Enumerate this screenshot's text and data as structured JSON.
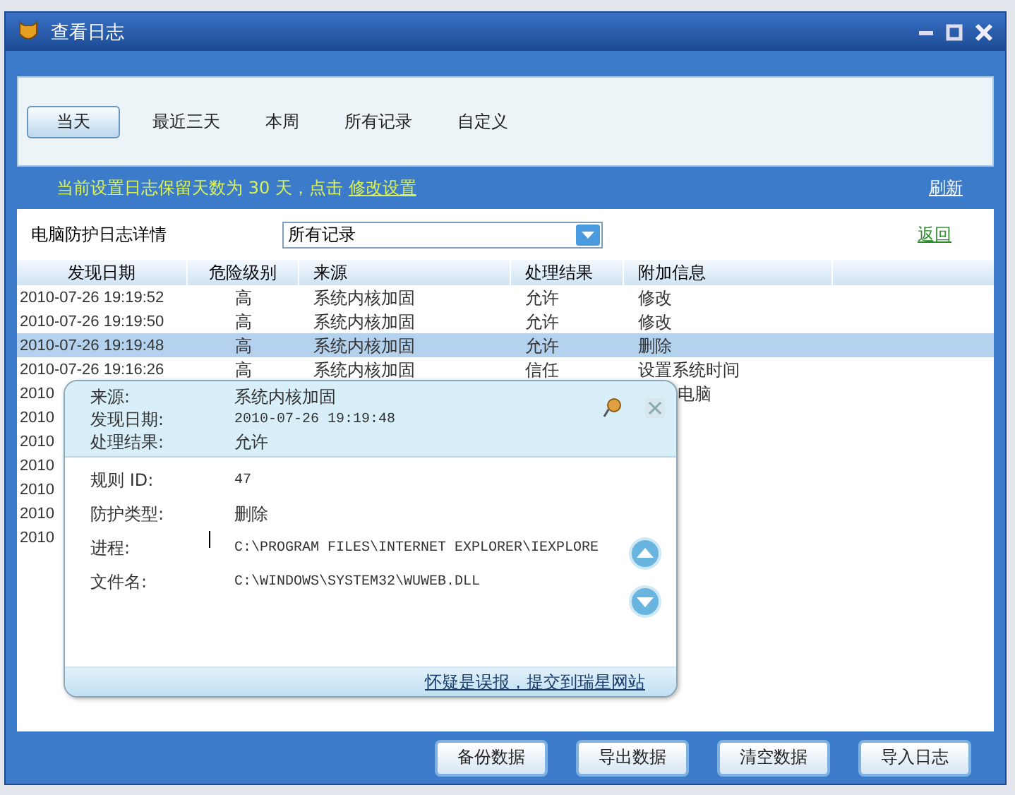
{
  "window": {
    "title": "查看日志"
  },
  "tabs": [
    {
      "label": "当天",
      "selected": true
    },
    {
      "label": "最近三天",
      "selected": false
    },
    {
      "label": "本周",
      "selected": false
    },
    {
      "label": "所有记录",
      "selected": false
    },
    {
      "label": "自定义",
      "selected": false
    }
  ],
  "notice": {
    "text": "当前设置日志保留天数为 30 天，点击",
    "link": "修改设置",
    "refresh": "刷新"
  },
  "filter": {
    "label": "电脑防护日志详情",
    "value": "所有记录",
    "back": "返回"
  },
  "table": {
    "columns": [
      "发现日期",
      "危险级别",
      "来源",
      "处理结果",
      "附加信息"
    ],
    "rows": [
      {
        "cells": [
          "2010-07-26 19:19:52",
          "高",
          "系统内核加固",
          "允许",
          "修改"
        ],
        "selected": false
      },
      {
        "cells": [
          "2010-07-26 19:19:50",
          "高",
          "系统内核加固",
          "允许",
          "修改"
        ],
        "selected": false
      },
      {
        "cells": [
          "2010-07-26 19:19:48",
          "高",
          "系统内核加固",
          "允许",
          "删除"
        ],
        "selected": true
      },
      {
        "cells": [
          "2010-07-26 19:16:26",
          "高",
          "系统内核加固",
          "信任",
          "设置系统时间"
        ],
        "selected": false
      },
      {
        "cells": [
          "2010",
          "",
          "",
          "",
          "电脑"
        ],
        "selected": false
      },
      {
        "cells": [
          "2010",
          "",
          "",
          "",
          ""
        ],
        "selected": false
      },
      {
        "cells": [
          "2010",
          "",
          "",
          "",
          ""
        ],
        "selected": false
      },
      {
        "cells": [
          "2010",
          "",
          "",
          "",
          ""
        ],
        "selected": false
      },
      {
        "cells": [
          "2010",
          "",
          "",
          "",
          ""
        ],
        "selected": false
      },
      {
        "cells": [
          "2010",
          "",
          "",
          "",
          ""
        ],
        "selected": false
      },
      {
        "cells": [
          "2010",
          "",
          "",
          "",
          ""
        ],
        "selected": false
      }
    ]
  },
  "popup": {
    "summary": [
      {
        "label": "来源:",
        "value": "系统内核加固"
      },
      {
        "label": "发现日期:",
        "value": "2010-07-26 19:19:48"
      },
      {
        "label": "处理结果:",
        "value": "允许"
      }
    ],
    "details": [
      {
        "label": "规则 ID:",
        "value": "47"
      },
      {
        "label": "防护类型:",
        "value": "删除"
      },
      {
        "label": "进程:",
        "value": "C:\\PROGRAM FILES\\INTERNET EXPLORER\\IEXPLORE"
      },
      {
        "label": "文件名:",
        "value": "C:\\WINDOWS\\SYSTEM32\\WUWEB.DLL"
      }
    ],
    "link": "怀疑是误报，提交到瑞星网站"
  },
  "buttons": [
    "备份数据",
    "导出数据",
    "清空数据",
    "导入日志"
  ]
}
